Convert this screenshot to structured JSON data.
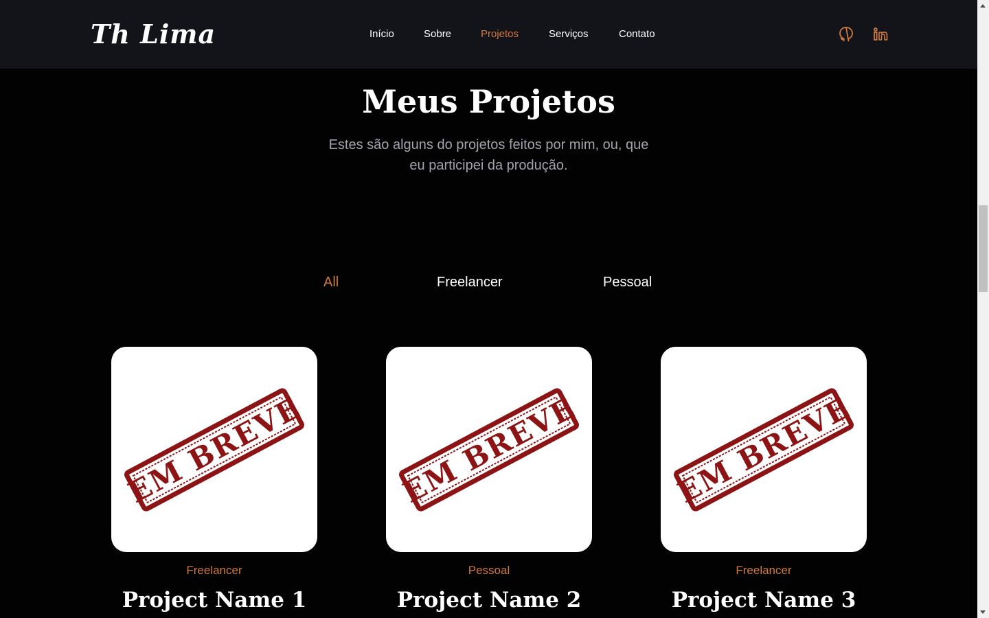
{
  "header": {
    "logo": "Th Lima",
    "nav": [
      {
        "label": "Início",
        "active": false
      },
      {
        "label": "Sobre",
        "active": false
      },
      {
        "label": "Projetos",
        "active": true
      },
      {
        "label": "Serviços",
        "active": false
      },
      {
        "label": "Contato",
        "active": false
      }
    ],
    "social": [
      "github-icon",
      "linkedin-icon"
    ]
  },
  "section": {
    "title": "Meus Projetos",
    "subtitle_line1": "Estes são alguns do projetos feitos por mim, ou, que",
    "subtitle_line2": "eu participei da produção."
  },
  "filters": [
    {
      "label": "All",
      "active": true
    },
    {
      "label": "Freelancer",
      "active": false
    },
    {
      "label": "Pessoal",
      "active": false
    }
  ],
  "projects": [
    {
      "category": "Freelancer",
      "name": "Project Name 1",
      "stamp": "EM BREVE"
    },
    {
      "category": "Pessoal",
      "name": "Project Name 2",
      "stamp": "EM BREVE"
    },
    {
      "category": "Freelancer",
      "name": "Project Name 3",
      "stamp": "EM BREVE"
    }
  ],
  "colors": {
    "accent": "#d07a3e",
    "header_bg": "#13141a",
    "page_bg": "#020202",
    "stamp": "#8c1414",
    "subtitle": "#a3a3ad"
  }
}
